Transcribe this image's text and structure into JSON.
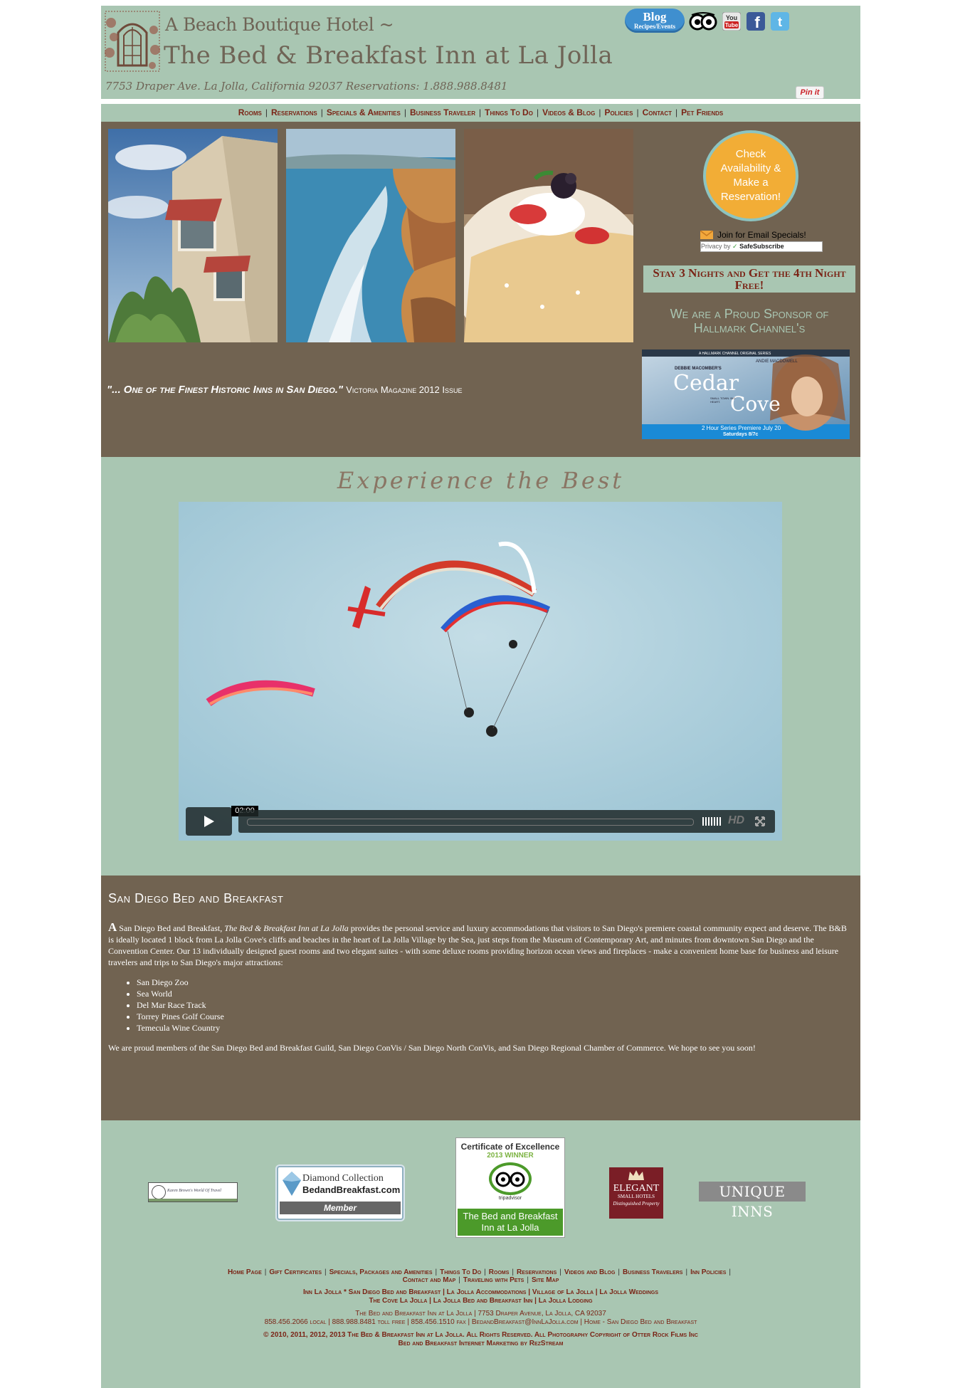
{
  "header": {
    "tagline": "A Beach Boutique Hotel ~",
    "inn_name": "The Bed & Breakfast Inn at La Jolla",
    "address": "7753 Draper Ave. La Jolla, California 92037 Reservations: 1.888.988.8481",
    "blog_label": "Blog",
    "blog_sub": "Recipes/Events",
    "social_icons": [
      "tripadvisor-icon",
      "youtube-icon",
      "facebook-icon",
      "twitter-icon"
    ],
    "pinit": "Pin it"
  },
  "nav": {
    "items": [
      "Rooms",
      "Reservations",
      "Specials & Amenities",
      "Business Traveler",
      "Things To Do",
      "Videos & Blog",
      "Policies",
      "Contact",
      "Pet Friends"
    ]
  },
  "hero": {
    "quote": "\"... One of the Finest Historic Inns in San Diego.\"",
    "quote_source": "Victoria Magazine 2012 Issue",
    "availability_button": "Check Availability & Make a Reservation!",
    "email_join": "Join for Email Specials!",
    "safesubscribe": "Privacy by",
    "safesubscribe_brand": "SafeSubscribe",
    "promo": "Stay 3 Nights and Get the 4th Night Free!",
    "sponsor": "We are a Proud Sponsor of Hallmark Channel's",
    "cedar_top": "A HALLMARK CHANNEL ORIGINAL SERIES",
    "cedar_actor": "ANDIE MACDOWELL",
    "cedar_author": "DEBBIE MACOMBER'S",
    "cedar_title1": "Cedar",
    "cedar_title2": "Cove",
    "cedar_tag": "SMALL TOWN. BIG HEART.",
    "cedar_premiere": "2 Hour Series Premiere July 20",
    "cedar_time": "Saturdays 8/7c"
  },
  "video": {
    "title": "Experience the Best",
    "duration": "02:00",
    "hd": "HD"
  },
  "description": {
    "heading": "San Diego Bed and Breakfast",
    "dropcap": "A",
    "intro_pre": " San Diego Bed and Breakfast, ",
    "intro_name": "The Bed & Breakfast Inn at La Jolla",
    "intro_post": " provides the personal service and luxury accommodations that visitors to San Diego's premiere coastal community expect and deserve. The B&B is ideally located 1 block from La Jolla Cove's cliffs and beaches in the heart of La Jolla Village by the Sea, just steps from the Museum of Contemporary Art, and minutes from downtown San Diego and the Convention Center. Our 13 individually designed guest rooms and two elegant suites - with some deluxe rooms providing horizon ocean views and fireplaces - make a convenient home base for business and leisure travelers and trips to San Diego's major attractions:",
    "attractions": [
      "San Diego Zoo",
      "Sea World",
      "Del Mar Race Track",
      "Torrey Pines Golf Course",
      "Temecula Wine Country"
    ],
    "closing": "We are proud members of the San Diego Bed and Breakfast Guild, San Diego ConVis / San Diego North ConVis, and San Diego Regional Chamber of Commerce. We hope to see you soon!"
  },
  "footer": {
    "karen_brown": "Karen Brown's World Of Travel",
    "diamond_1": "Diamond Collection",
    "diamond_2": "BedandBreakfast.com",
    "diamond_3": "Member",
    "cert_title": "Certificate of Excellence",
    "cert_year": "2013 WINNER",
    "cert_brand": "tripadvisor",
    "cert_name": "The Bed and Breakfast Inn at La Jolla",
    "elegant_1": "ELEGANT",
    "elegant_2": "SMALL HOTELS",
    "elegant_3": "Distinguished Property",
    "unique_inns": "UNIQUE INNS",
    "links_row1": [
      "Home Page",
      "Gift Certificates",
      "Specials, Packages and Amenities",
      "Things To Do",
      "Rooms",
      "Reservations",
      "Videos and Blog",
      "Business Travelers",
      "Inn Policies",
      "Contact and Map",
      "Traveling with Pets",
      "Site Map"
    ],
    "seo_line1": "Inn La Jolla * San Diego Bed and Breakfast | La Jolla Accommodations | Village of La Jolla | La Jolla Weddings",
    "seo_line2": "The Cove La Jolla | La Jolla Bed and Breakfast Inn | La Jolla Lodging",
    "contact_line1": "The Bed and Breakfast Inn at La Jolla | 7753 Draper Avenue, La Jolla, CA 92037",
    "contact_line2": "858.456.2066 local | 888.988.8481 toll free | 858.456.1510 fax | BedandBreakfast@InnLaJolla.com | Home - San Diego Bed and Breakfast",
    "copyright1": "© 2010, 2011, 2012, 2013 The Bed & Breakfast Inn at La Jolla. All Rights Reserved. All Photography Copyright of Otter Rock Films Inc",
    "copyright2": "Bed and Breakfast Internet Marketing by RezStream"
  }
}
